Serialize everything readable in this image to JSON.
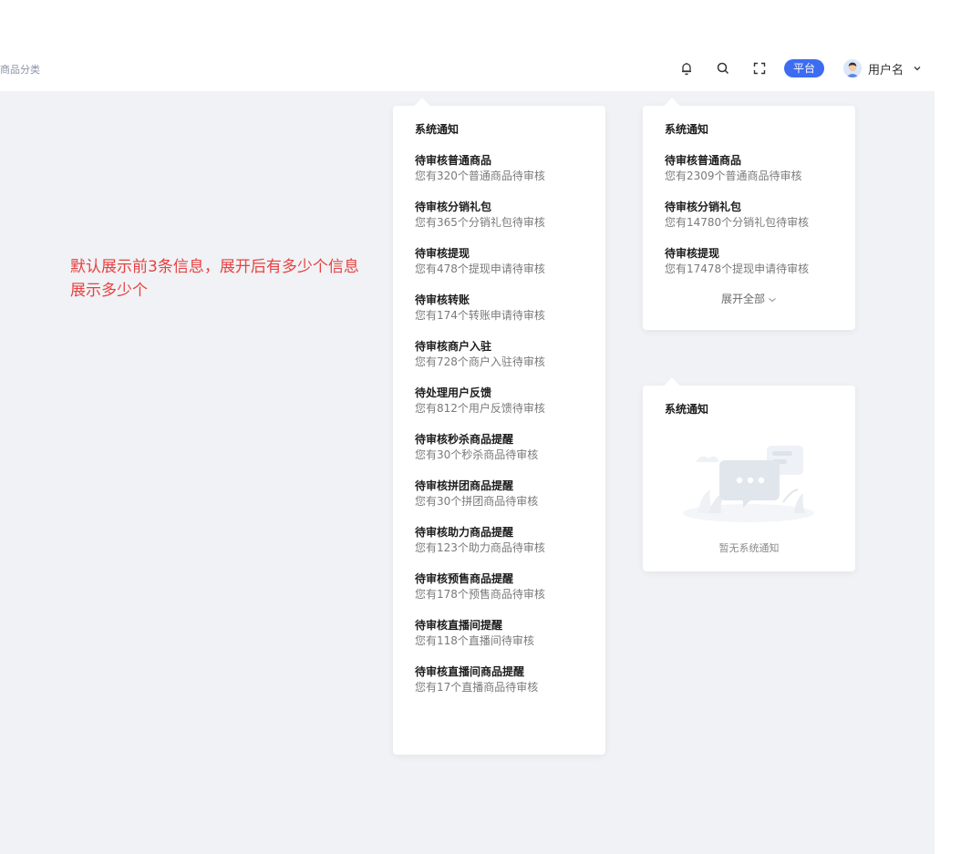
{
  "header": {
    "breadcrumb": "商品分类",
    "platform_badge": "平台",
    "user_name": "用户名",
    "icons": [
      "bell-icon",
      "search-icon",
      "fullscreen-icon",
      "avatar",
      "chevron-down-icon"
    ]
  },
  "annotation": "默认展示前3条信息，展开后有多少个信息展示多少个",
  "panel_full": {
    "title": "系统通知",
    "items": [
      {
        "title": "待审核普通商品",
        "desc": "您有320个普通商品待审核"
      },
      {
        "title": "待审核分销礼包",
        "desc": "您有365个分销礼包待审核"
      },
      {
        "title": "待审核提现",
        "desc": "您有478个提现申请待审核"
      },
      {
        "title": "待审核转账",
        "desc": "您有174个转账申请待审核"
      },
      {
        "title": "待审核商户入驻",
        "desc": "您有728个商户入驻待审核"
      },
      {
        "title": "待处理用户反馈",
        "desc": "您有812个用户反馈待审核"
      },
      {
        "title": "待审核秒杀商品提醒",
        "desc": "您有30个秒杀商品待审核"
      },
      {
        "title": "待审核拼团商品提醒",
        "desc": "您有30个拼团商品待审核"
      },
      {
        "title": "待审核助力商品提醒",
        "desc": "您有123个助力商品待审核"
      },
      {
        "title": "待审核预售商品提醒",
        "desc": "您有178个预售商品待审核"
      },
      {
        "title": "待审核直播间提醒",
        "desc": "您有118个直播间待审核"
      },
      {
        "title": "待审核直播间商品提醒",
        "desc": "您有17个直播商品待审核"
      }
    ]
  },
  "panel_collapsed": {
    "title": "系统通知",
    "items": [
      {
        "title": "待审核普通商品",
        "desc": "您有2309个普通商品待审核"
      },
      {
        "title": "待审核分销礼包",
        "desc": "您有14780个分销礼包待审核"
      },
      {
        "title": "待审核提现",
        "desc": "您有17478个提现申请待审核"
      }
    ],
    "expand_label": "展开全部"
  },
  "panel_empty": {
    "title": "系统通知",
    "empty_text": "暂无系统通知"
  },
  "colors": {
    "accent": "#3d6cf1",
    "annotation": "#e84141",
    "canvas_bg": "#f0f2f5"
  }
}
